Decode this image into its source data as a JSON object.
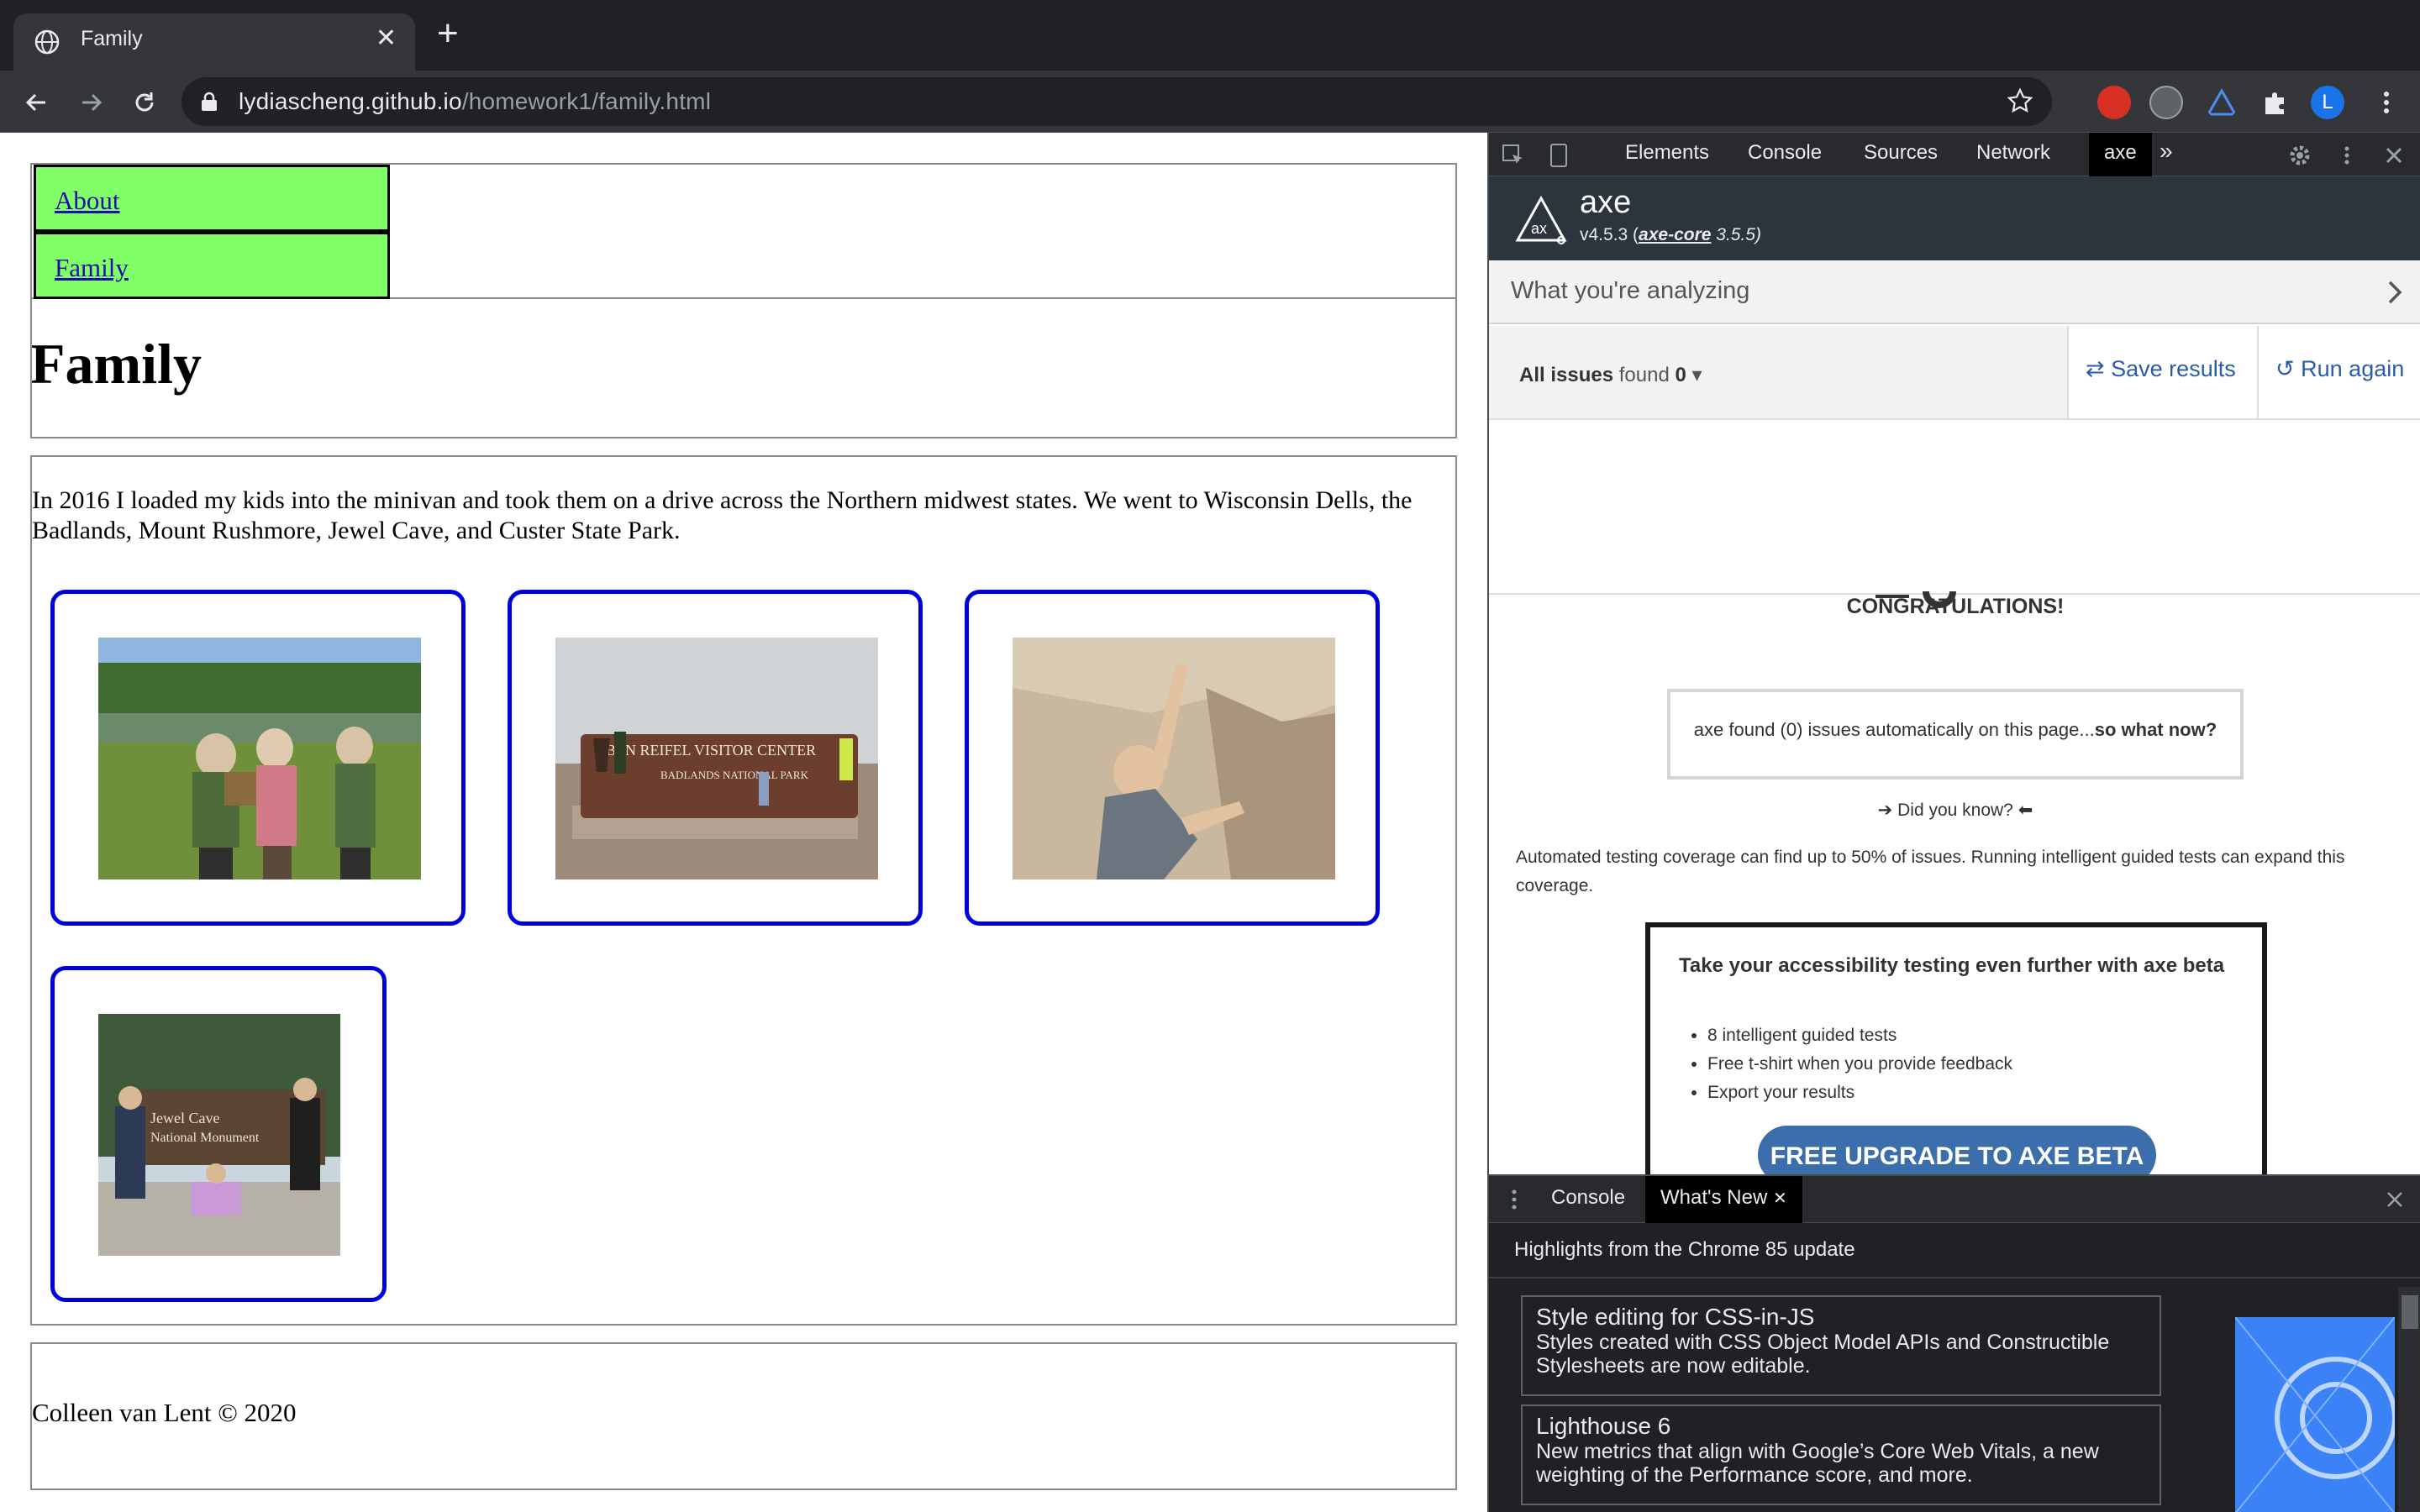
{
  "browser": {
    "tab_title": "Family",
    "url_host": "lydiascheng.github.io",
    "url_path": "/homework1/family.html",
    "new_tab_symbol": "+",
    "tab_close_symbol": "✕",
    "extension_avatar_letter": "L"
  },
  "page": {
    "nav": [
      {
        "label": "About"
      },
      {
        "label": "Family"
      }
    ],
    "heading": "Family",
    "intro": "In 2016 I loaded my kids into the minivan and took them on a drive across the Northern midwest states. We went to Wisconsin Dells, the Badlands, Mount Rushmore, Jewel Cave, and Custer State Park.",
    "photos": [
      {
        "icon": "kids-by-lake-photo"
      },
      {
        "icon": "badlands-visitor-center-photo",
        "sign_text": "BEN REIFEL VISITOR CENTER",
        "sign_sub": "BADLANDS NATIONAL PARK"
      },
      {
        "icon": "boy-climbing-rock-photo"
      },
      {
        "icon": "jewel-cave-sign-photo",
        "sign_text": "Jewel Cave",
        "sign_sub": "National Monument"
      }
    ],
    "footer": "Colleen van Lent © 2020"
  },
  "devtools": {
    "tabs": [
      "Elements",
      "Console",
      "Sources",
      "Network",
      "axe"
    ],
    "active_tab": "axe",
    "more_symbol": "»",
    "axe": {
      "name": "axe",
      "version_prefix": "v4.5.3 (",
      "core_label": "axe-core",
      "core_version": " 3.5.5)",
      "analyzing": "What you're analyzing",
      "issues_label": "All issues",
      "issues_found": "found",
      "issues_count": "0",
      "save_results": "Save results",
      "run_again": "Run again",
      "congrats": "CONGRATULATIONS!",
      "found_text": "axe found (0) issues automatically on this page...",
      "found_link": "so what now?",
      "did_you_know": "Did you know?",
      "automated_text": "Automated testing coverage can find up to 50% of issues. Running intelligent guided tests can expand this coverage.",
      "beta_title": "Take your accessibility testing even further with axe beta",
      "beta_items": [
        "8 intelligent guided tests",
        "Free t-shirt when you provide feedback",
        "Export your results"
      ],
      "beta_button": "FREE UPGRADE TO AXE BETA"
    },
    "drawer": {
      "tabs": [
        "Console",
        "What's New"
      ],
      "active_tab": "What's New",
      "highlights": "Highlights from the Chrome 85 update",
      "cards": [
        {
          "title": "Style editing for CSS-in-JS",
          "desc": "Styles created with CSS Object Model APIs and Constructible Stylesheets are now editable."
        },
        {
          "title": "Lighthouse 6",
          "desc": "New metrics that align with Google’s Core Web Vitals, a new weighting of the Performance score, and more."
        }
      ]
    }
  }
}
